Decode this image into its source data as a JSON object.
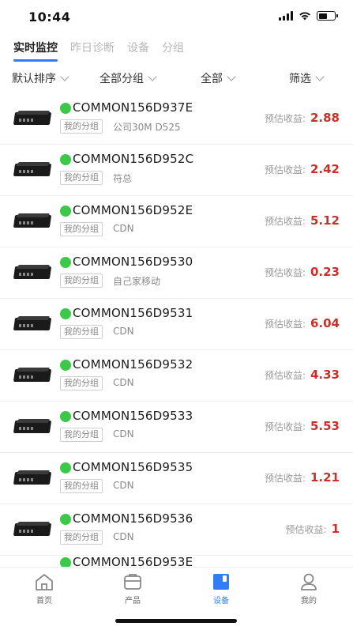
{
  "status_bar": {
    "time": "10:44",
    "battery_level": 0.55
  },
  "top_tabs": [
    {
      "label": "实时监控",
      "active": true
    },
    {
      "label": "昨日诊断",
      "active": false
    },
    {
      "label": "设备",
      "active": false
    },
    {
      "label": "分组",
      "active": false
    }
  ],
  "filters": {
    "sort": "默认排序",
    "group": "全部分组",
    "all": "全部",
    "screen": "筛选"
  },
  "devices": [
    {
      "name": "COMMON156D937E",
      "tag": "我的分组",
      "remark": "公司30M D525",
      "earn_label": "预估收益:",
      "earn_value": "2.88",
      "status_color": "#3cc94a"
    },
    {
      "name": "COMMON156D952C",
      "tag": "我的分组",
      "remark": "符总",
      "earn_label": "预估收益:",
      "earn_value": "2.42",
      "status_color": "#3cc94a"
    },
    {
      "name": "COMMON156D952E",
      "tag": "我的分组",
      "remark": "CDN",
      "earn_label": "预估收益:",
      "earn_value": "5.12",
      "status_color": "#3cc94a"
    },
    {
      "name": "COMMON156D9530",
      "tag": "我的分组",
      "remark": "自己家移动",
      "earn_label": "预估收益:",
      "earn_value": "0.23",
      "status_color": "#3cc94a"
    },
    {
      "name": "COMMON156D9531",
      "tag": "我的分组",
      "remark": "CDN",
      "earn_label": "预估收益:",
      "earn_value": "6.04",
      "status_color": "#3cc94a"
    },
    {
      "name": "COMMON156D9532",
      "tag": "我的分组",
      "remark": "CDN",
      "earn_label": "预估收益:",
      "earn_value": "4.33",
      "status_color": "#3cc94a"
    },
    {
      "name": "COMMON156D9533",
      "tag": "我的分组",
      "remark": "CDN",
      "earn_label": "预估收益:",
      "earn_value": "5.53",
      "status_color": "#3cc94a"
    },
    {
      "name": "COMMON156D9535",
      "tag": "我的分组",
      "remark": "CDN",
      "earn_label": "预估收益:",
      "earn_value": "1.21",
      "status_color": "#3cc94a"
    },
    {
      "name": "COMMON156D9536",
      "tag": "我的分组",
      "remark": "CDN",
      "earn_label": "预估收益:",
      "earn_value": "1",
      "status_color": "#3cc94a"
    }
  ],
  "partial_device": {
    "name": "COMMON156D953E"
  },
  "bottom_nav": [
    {
      "label": "首页",
      "icon": "home-icon",
      "active": false
    },
    {
      "label": "产品",
      "icon": "product-icon",
      "active": false
    },
    {
      "label": "设备",
      "icon": "device-icon",
      "active": true
    },
    {
      "label": "我的",
      "icon": "profile-icon",
      "active": false
    }
  ],
  "colors": {
    "accent": "#2f7ef5",
    "online": "#3cc94a",
    "earnings": "#c8302a"
  }
}
